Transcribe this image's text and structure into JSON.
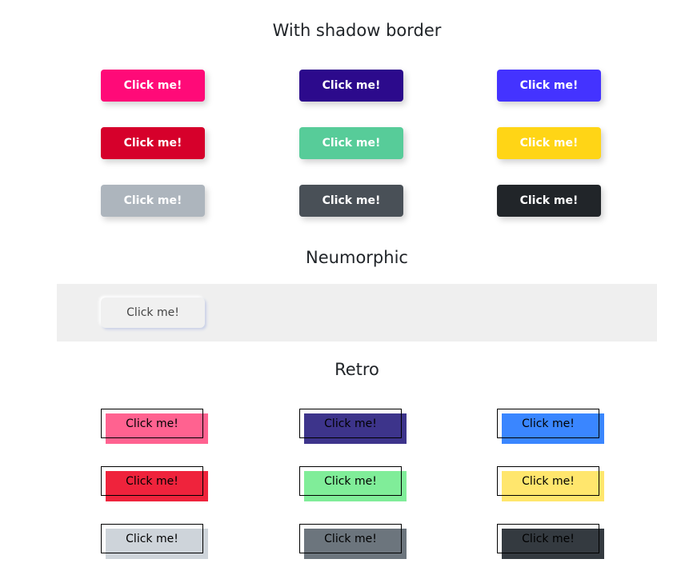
{
  "sections": {
    "shadow": "With shadow border",
    "neumorphic": "Neumorphic",
    "retro": "Retro"
  },
  "button_label": "Click me!",
  "shadow_colors": [
    "#ff0a78",
    "#2c0a8c",
    "#4433ff",
    "#d6002b",
    "#57cc99",
    "#ffd516",
    "#adb5bd",
    "#495057",
    "#212529"
  ],
  "retro_colors": [
    "#ff6290",
    "#3d348b",
    "#3a86ff",
    "#ef233c",
    "#80ed99",
    "#ffe66d",
    "#ced4da",
    "#6c757d",
    "#343a40"
  ]
}
